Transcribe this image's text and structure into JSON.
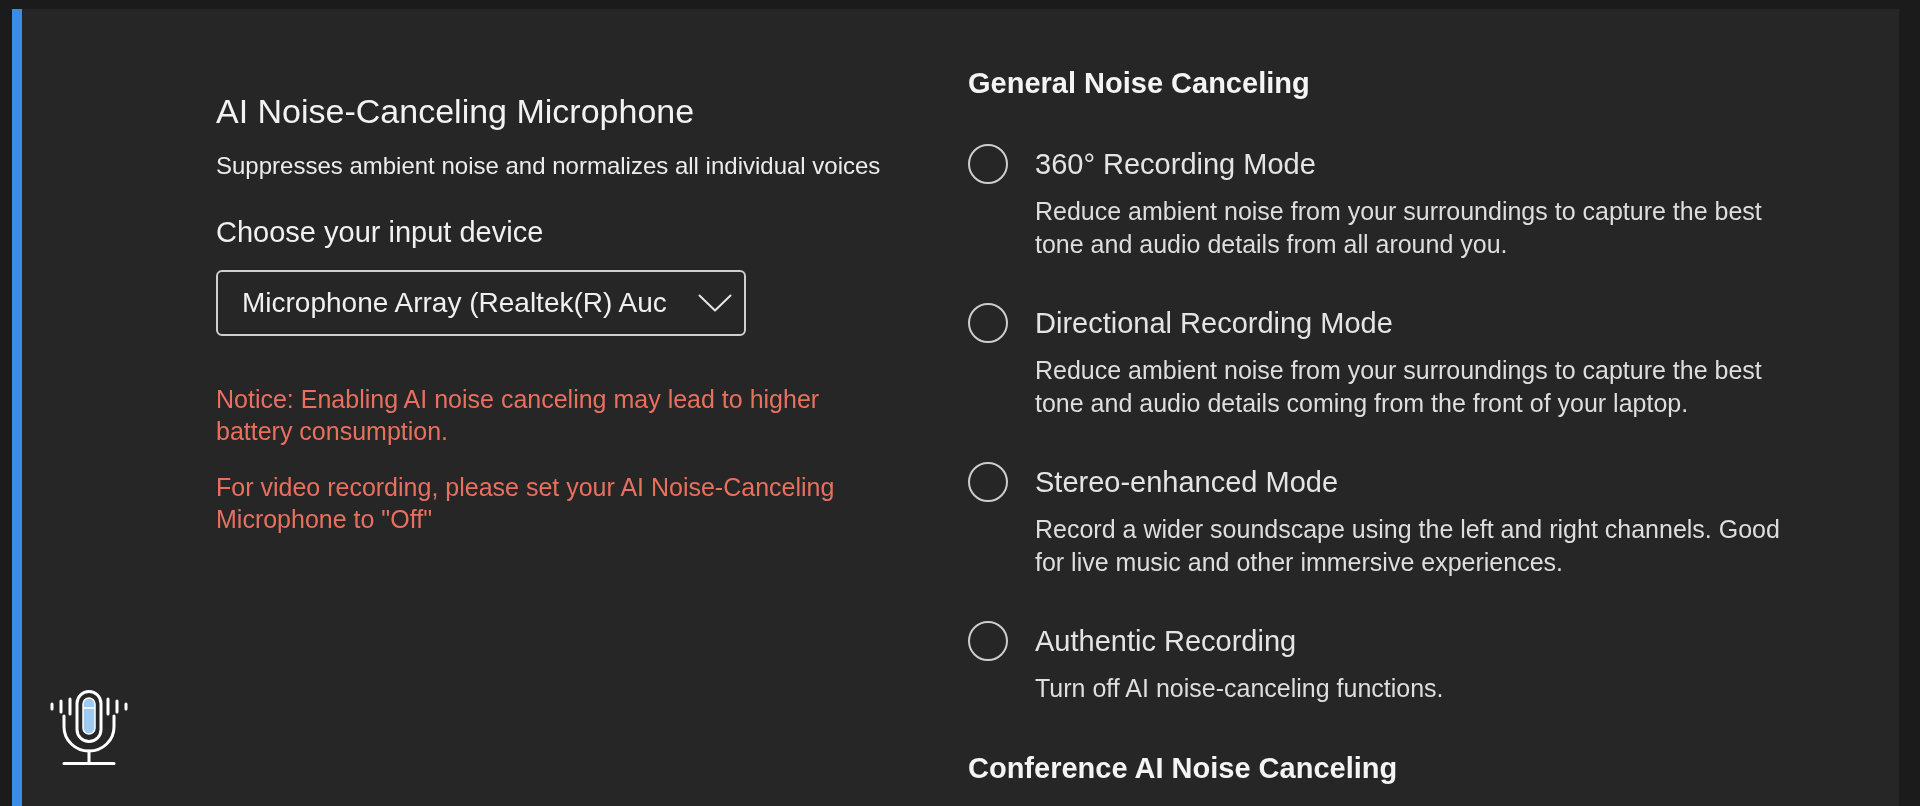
{
  "microphone": {
    "title": "AI Noise-Canceling Microphone",
    "description": "Suppresses ambient noise and normalizes all individual voices",
    "device_label": "Choose your input device",
    "device_dropdown": {
      "value": "Microphone Array (Realtek(R) Auc"
    },
    "notices": [
      "Notice: Enabling AI noise canceling may lead to higher battery consumption.",
      "For video recording, please set your AI Noise-Canceling Microphone to \"Off\""
    ]
  },
  "general_noise_canceling": {
    "heading": "General Noise Canceling",
    "modes": [
      {
        "label": "360° Recording Mode",
        "description": "Reduce ambient noise from your surroundings to capture the best tone and audio details from all around you.",
        "selected": false
      },
      {
        "label": "Directional Recording Mode",
        "description": "Reduce ambient noise from your surroundings to capture the best tone and audio details coming from the front of your laptop.",
        "selected": false
      },
      {
        "label": "Stereo-enhanced Mode",
        "description": "Record a wider soundscape using the left and right channels. Good for live music and other immersive experiences.",
        "selected": false
      },
      {
        "label": "Authentic Recording",
        "description": "Turn off AI noise-canceling functions.",
        "selected": false
      }
    ]
  },
  "conference_noise_canceling": {
    "heading": "Conference AI Noise Canceling"
  }
}
